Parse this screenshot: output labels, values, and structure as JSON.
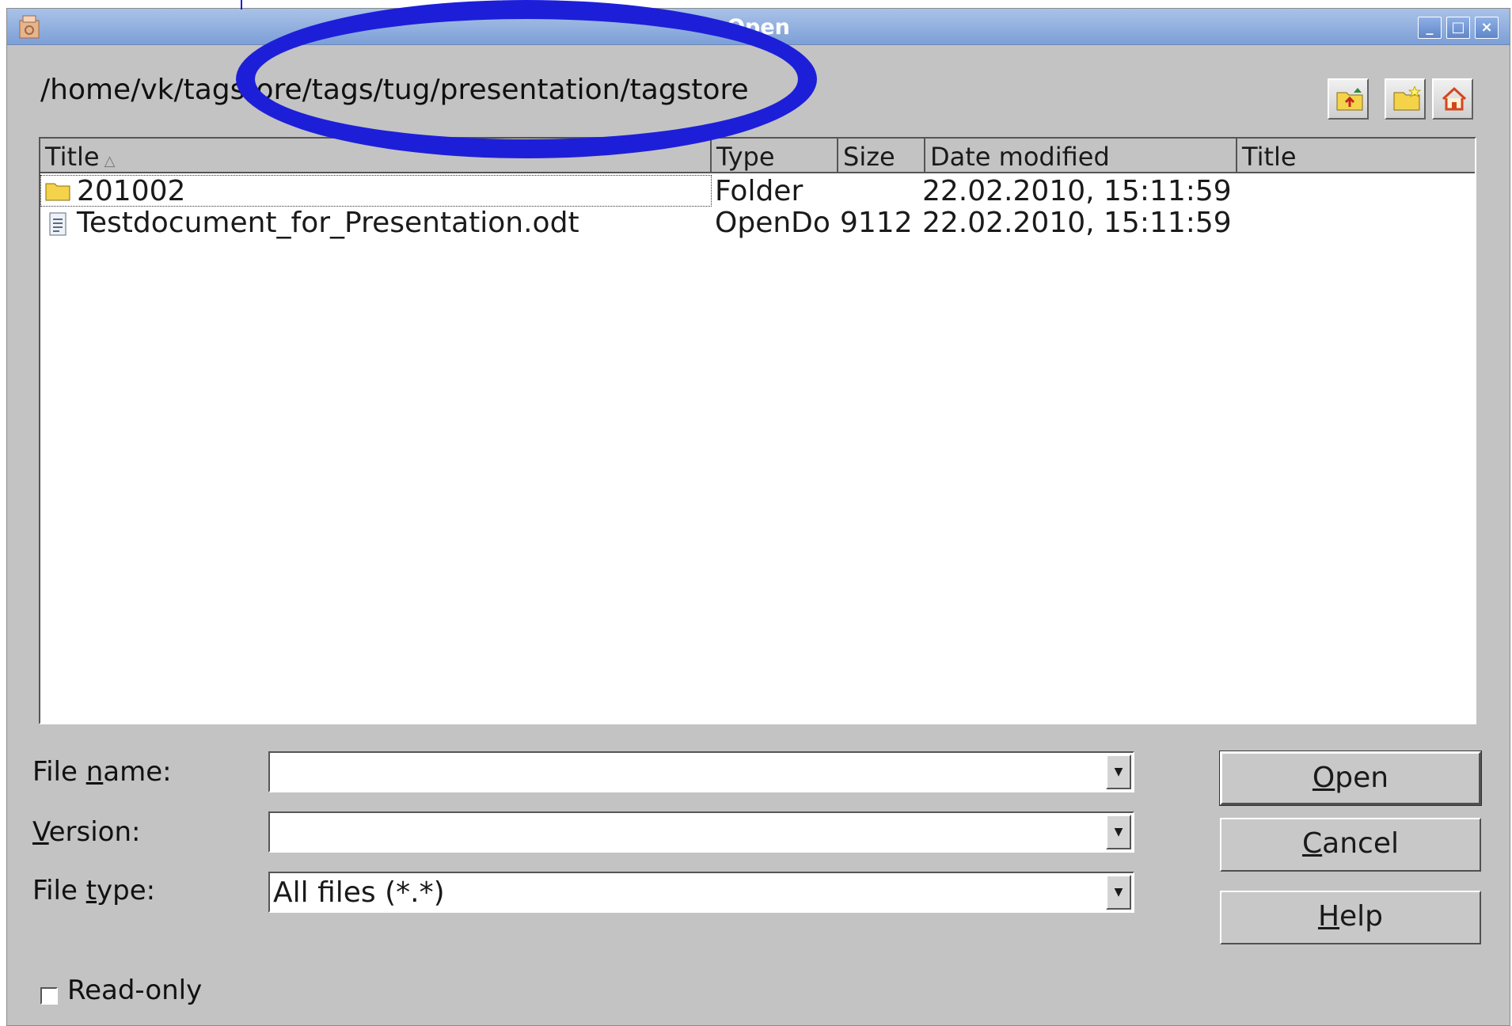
{
  "window": {
    "title": "Open",
    "controls": [
      "minimize",
      "maximize",
      "close"
    ]
  },
  "path": "/home/vk/tagstore/tags/tug/presentation/tagstore",
  "toolbar": {
    "buttons": [
      "folder-up-icon",
      "new-folder-icon",
      "home-icon"
    ]
  },
  "columns": [
    "Title",
    "Type",
    "Size",
    "Date modified",
    "Title"
  ],
  "files": [
    {
      "title": "201002",
      "type": "Folder",
      "size": "",
      "date": "22.02.2010, 15:11:59",
      "kind": "folder"
    },
    {
      "title": "Testdocument_for_Presentation.odt",
      "type": "OpenDo",
      "size": "9112",
      "date": "22.02.2010, 15:11:59",
      "kind": "document"
    }
  ],
  "form": {
    "file_name_label_pre": "File ",
    "file_name_label_key": "n",
    "file_name_label_post": "ame:",
    "file_name_value": "",
    "version_label_key": "V",
    "version_label_post": "ersion:",
    "version_value": "",
    "file_type_label_pre": "File ",
    "file_type_label_key": "t",
    "file_type_label_post": "ype:",
    "file_type_value": "All files (*.*)"
  },
  "buttons": {
    "open_key": "O",
    "open_rest": "pen",
    "cancel_key": "C",
    "cancel_rest": "ancel",
    "help_key": "H",
    "help_rest": "elp"
  },
  "read_only": {
    "label": "Read-only",
    "checked": false
  },
  "annotation_color": "#1d1fd8"
}
